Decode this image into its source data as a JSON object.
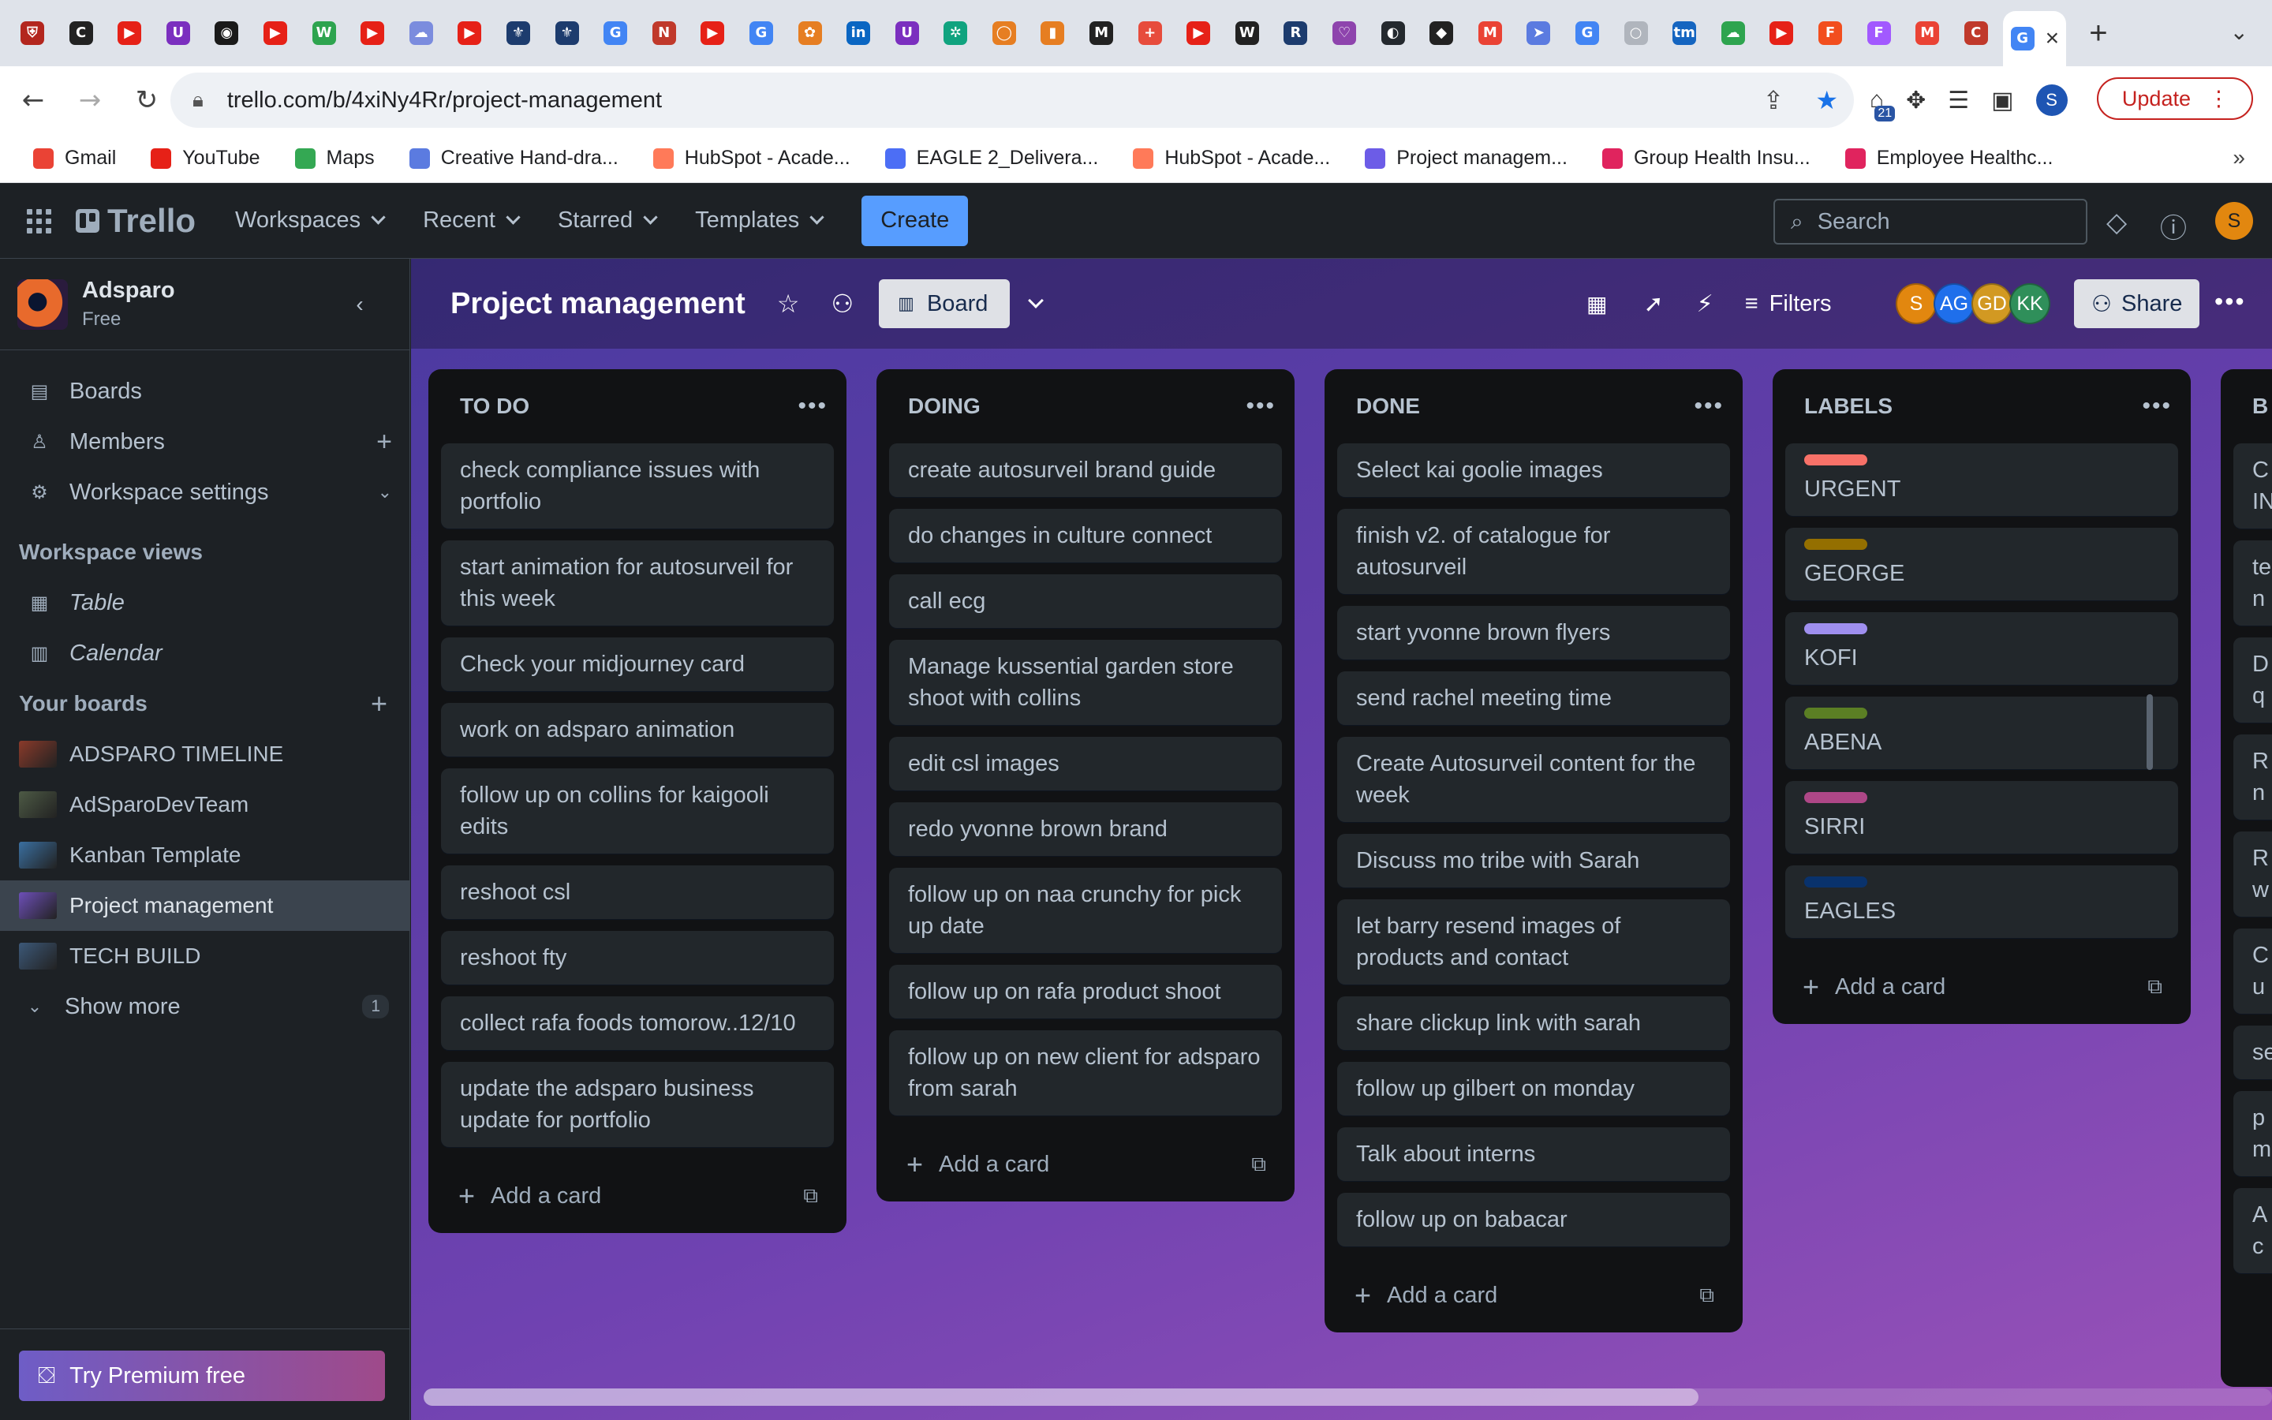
{
  "browser": {
    "url": "trello.com/b/4xiNy4Rr/project-management",
    "update_label": "Update",
    "extension_badge": "21",
    "profile_initial": "S",
    "tab_favicons": [
      {
        "icon": "shield-icon",
        "color": "#b3261e",
        "glyph": "⛨"
      },
      {
        "icon": "cnbc-icon",
        "color": "#222222",
        "glyph": "C"
      },
      {
        "icon": "youtube-icon",
        "color": "#e62117",
        "glyph": "▶"
      },
      {
        "icon": "upwork-icon",
        "color": "#7b2fbf",
        "glyph": "U"
      },
      {
        "icon": "aperture-icon",
        "color": "#1a1a1a",
        "glyph": "◉"
      },
      {
        "icon": "youtube-icon",
        "color": "#e62117",
        "glyph": "▶"
      },
      {
        "icon": "webflow-icon",
        "color": "#2ea44f",
        "glyph": "W"
      },
      {
        "icon": "youtube-icon",
        "color": "#e62117",
        "glyph": "▶"
      },
      {
        "icon": "cloud-icon",
        "color": "#7b8cde",
        "glyph": "☁"
      },
      {
        "icon": "youtube-icon",
        "color": "#e62117",
        "glyph": "▶"
      },
      {
        "icon": "gov-icon",
        "color": "#1d3c6e",
        "glyph": "⚜"
      },
      {
        "icon": "gov-icon",
        "color": "#1d3c6e",
        "glyph": "⚜"
      },
      {
        "icon": "google-icon",
        "color": "#4285f4",
        "glyph": "G"
      },
      {
        "icon": "n-icon",
        "color": "#c0392b",
        "glyph": "N"
      },
      {
        "icon": "youtube-icon",
        "color": "#e62117",
        "glyph": "▶"
      },
      {
        "icon": "google-icon",
        "color": "#4285f4",
        "glyph": "G"
      },
      {
        "icon": "pinwheel-icon",
        "color": "#e67e22",
        "glyph": "✿"
      },
      {
        "icon": "linkedin-icon",
        "color": "#0a66c2",
        "glyph": "in"
      },
      {
        "icon": "upwork-icon",
        "color": "#7b2fbf",
        "glyph": "U"
      },
      {
        "icon": "chatgpt-icon",
        "color": "#10a37f",
        "glyph": "✲"
      },
      {
        "icon": "circle-icon",
        "color": "#e67e22",
        "glyph": "◯"
      },
      {
        "icon": "notebook-icon",
        "color": "#e67e22",
        "glyph": "▮"
      },
      {
        "icon": "mailchimp-icon",
        "color": "#222222",
        "glyph": "M"
      },
      {
        "icon": "plus-icon",
        "color": "#e74c3c",
        "glyph": "+"
      },
      {
        "icon": "youtube-icon",
        "color": "#e62117",
        "glyph": "▶"
      },
      {
        "icon": "wix-icon",
        "color": "#222222",
        "glyph": "W"
      },
      {
        "icon": "r-icon",
        "color": "#1d3c6e",
        "glyph": "R"
      },
      {
        "icon": "heart-icon",
        "color": "#8e44ad",
        "glyph": "♡"
      },
      {
        "icon": "github-icon",
        "color": "#24292e",
        "glyph": "◐"
      },
      {
        "icon": "hat-icon",
        "color": "#222222",
        "glyph": "◆"
      },
      {
        "icon": "gmail-icon",
        "color": "#ea4335",
        "glyph": "M"
      },
      {
        "icon": "send-icon",
        "color": "#5b7be0",
        "glyph": "➤"
      },
      {
        "icon": "google-icon",
        "color": "#4285f4",
        "glyph": "G"
      },
      {
        "icon": "blank-icon",
        "color": "#b0b5bd",
        "glyph": "○"
      },
      {
        "icon": "tm-icon",
        "color": "#1565c0",
        "glyph": "tm"
      },
      {
        "icon": "cloud-icon",
        "color": "#2ea44f",
        "glyph": "☁"
      },
      {
        "icon": "youtube-icon",
        "color": "#e62117",
        "glyph": "▶"
      },
      {
        "icon": "figma-icon",
        "color": "#f24e1e",
        "glyph": "F"
      },
      {
        "icon": "figma-icon",
        "color": "#a259ff",
        "glyph": "F"
      },
      {
        "icon": "gmail-icon",
        "color": "#ea4335",
        "glyph": "M"
      },
      {
        "icon": "c-icon",
        "color": "#c0392b",
        "glyph": "C"
      },
      {
        "icon": "google-icon",
        "color": "#4285f4",
        "glyph": "G"
      }
    ],
    "bookmarks": [
      {
        "label": "Gmail",
        "icon": "gmail-icon",
        "color": "#ea4335"
      },
      {
        "label": "YouTube",
        "icon": "youtube-icon",
        "color": "#e62117"
      },
      {
        "label": "Maps",
        "icon": "maps-icon",
        "color": "#34a853"
      },
      {
        "label": "Creative Hand-dra...",
        "icon": "globe-icon",
        "color": "#5b7be0"
      },
      {
        "label": "HubSpot - Acade...",
        "icon": "hubspot-icon",
        "color": "#ff7a59"
      },
      {
        "label": "EAGLE 2_Delivera...",
        "icon": "doc-icon",
        "color": "#4c6ef5"
      },
      {
        "label": "HubSpot - Acade...",
        "icon": "hubspot-icon",
        "color": "#ff7a59"
      },
      {
        "label": "Project managem...",
        "icon": "trello-icon",
        "color": "#6c5ce7"
      },
      {
        "label": "Group Health Insu...",
        "icon": "pv-icon",
        "color": "#e0245e"
      },
      {
        "label": "Employee Healthc...",
        "icon": "pv-icon",
        "color": "#e0245e"
      }
    ]
  },
  "app": {
    "logo_text": "Trello",
    "nav": [
      "Workspaces",
      "Recent",
      "Starred",
      "Templates"
    ],
    "create_label": "Create",
    "search_placeholder": "Search",
    "avatar_initial": "S"
  },
  "sidebar": {
    "workspace_name": "Adsparo",
    "workspace_plan": "Free",
    "nav": [
      {
        "label": "Boards",
        "icon": "board-icon"
      },
      {
        "label": "Members",
        "icon": "person-icon"
      },
      {
        "label": "Workspace settings",
        "icon": "gear-icon"
      }
    ],
    "views_heading": "Workspace views",
    "views": [
      {
        "label": "Table",
        "icon": "table-icon"
      },
      {
        "label": "Calendar",
        "icon": "calendar-icon"
      }
    ],
    "boards_heading": "Your boards",
    "boards": [
      {
        "label": "ADSPARO TIMELINE",
        "thumb": "#8a3a2a"
      },
      {
        "label": "AdSparoDevTeam",
        "thumb": "#4d5a45"
      },
      {
        "label": "Kanban Template",
        "thumb": "#3a6fa0"
      },
      {
        "label": "Project management",
        "thumb": "#6d4fb8"
      },
      {
        "label": "TECH BUILD",
        "thumb": "#3c5878"
      }
    ],
    "show_more_label": "Show more",
    "show_more_count": "1",
    "premium_label": "Try Premium free"
  },
  "board": {
    "title": "Project management",
    "view_label": "Board",
    "filters_label": "Filters",
    "share_label": "Share",
    "members": [
      {
        "initials": "S",
        "color": "#e2870f"
      },
      {
        "initials": "AG",
        "color": "#1f6feb"
      },
      {
        "initials": "GD",
        "color": "#d29922"
      },
      {
        "initials": "KK",
        "color": "#2f8f5a"
      }
    ],
    "add_card_label": "Add a card",
    "lists": [
      {
        "title": "TO DO",
        "cards": [
          "check compliance issues with portfolio",
          "start animation for autosurveil for this week",
          "Check your midjourney card",
          "work on adsparo animation",
          "follow up on collins for kaigooli edits",
          "reshoot csl",
          "reshoot fty",
          "collect rafa foods tomorow..12/10",
          "update the adsparo business update for portfolio"
        ]
      },
      {
        "title": "DOING",
        "cards": [
          "create autosurveil brand guide",
          "do changes in culture connect",
          "call ecg",
          "Manage kussential garden store shoot with collins",
          "edit csl images",
          "redo yvonne brown brand",
          "follow up on naa crunchy for pick up date",
          "follow up on rafa product shoot",
          "follow up on new client for adsparo from sarah"
        ]
      },
      {
        "title": "DONE",
        "cards": [
          "Select kai goolie images",
          "finish v2. of catalogue for autosurveil",
          "start yvonne brown flyers",
          "send rachel meeting time",
          "Create Autosurveil content for the week",
          "Discuss mo tribe with Sarah",
          "let barry resend images of products and contact",
          "share clickup link with sarah",
          "follow up gilbert on monday",
          "Talk about interns",
          "follow up on babacar"
        ]
      },
      {
        "title": "LABELS",
        "cards": [
          {
            "text": "URGENT",
            "label_color": "#f87168"
          },
          {
            "text": "GEORGE",
            "label_color": "#946f00"
          },
          {
            "text": "KOFI",
            "label_color": "#9f8fef"
          },
          {
            "text": "ABENA",
            "label_color": "#5b7f24"
          },
          {
            "text": "SIRRI",
            "label_color": "#ae4787"
          },
          {
            "text": "EAGLES",
            "label_color": "#09326c"
          }
        ]
      }
    ],
    "partial_list": {
      "title_fragment": "B",
      "card_fragments": [
        "C\nIN",
        "te\nn",
        "D\nq",
        "R\nn",
        "R\nw",
        "C\nu",
        "se",
        "p\nm",
        "A\nc"
      ]
    }
  }
}
